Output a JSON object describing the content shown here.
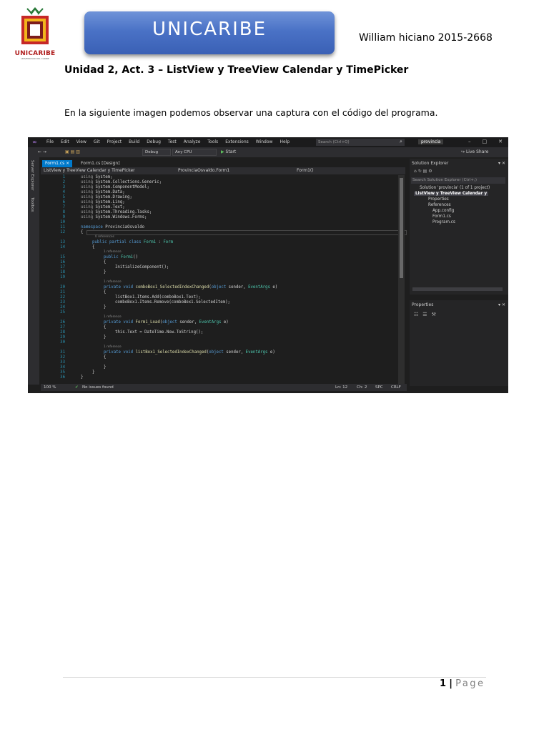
{
  "logo": {
    "text": "UNICARIBE",
    "subtitle": "UNIVERSIDAD DEL CARIBE",
    "colors": [
      "#2a7a3a",
      "#c62828",
      "#f2b51c"
    ]
  },
  "banner": {
    "text": "UNICARIBE",
    "color": "#4a72c6"
  },
  "author": "William hiciano 2015-2668",
  "heading": "Unidad 2, Act. 3 – ListView y TreeView Calendar y TimePicker",
  "paragraph": "En la siguiente imagen podemos observar una captura con el código del programa.",
  "screenshot": {
    "menu": [
      "File",
      "Edit",
      "View",
      "Git",
      "Project",
      "Build",
      "Debug",
      "Test",
      "Analyze",
      "Tools",
      "Extensions",
      "Window",
      "Help"
    ],
    "search_placeholder": "Search (Ctrl+Q)",
    "solution_name": "provincia",
    "config": "Debug",
    "platform": "Any CPU",
    "start": "Start",
    "live_share": "Live Share",
    "side_tabs": [
      "Server Explorer",
      "Toolbox"
    ],
    "tab_active": "Form1.cs",
    "tab_design": "Form1.cs [Design]",
    "nav_project": "ListView y TreeView Calendar y TimePicker",
    "nav_class": "ProvinciaOsvaldo.Form1",
    "nav_member": "Form1()",
    "references_label": "1 reference",
    "zero_references": "0 references",
    "code_lines": [
      {
        "n": "1",
        "u": "System"
      },
      {
        "n": "2",
        "u": "System.Collections.Generic"
      },
      {
        "n": "3",
        "u": "System.ComponentModel"
      },
      {
        "n": "4",
        "u": "System.Data"
      },
      {
        "n": "5",
        "u": "System.Drawing"
      },
      {
        "n": "6",
        "u": "System.Linq"
      },
      {
        "n": "7",
        "u": "System.Text"
      },
      {
        "n": "8",
        "u": "System.Threading.Tasks"
      },
      {
        "n": "9",
        "u": "System.Windows.Forms"
      }
    ],
    "ns_name": "ProvinciaOsvaldo",
    "class_name": "Form1",
    "base_class": "Form",
    "init_call": "InitializeComponent();",
    "method1": "comboBox1_SelectedIndexChanged",
    "m1_line1": "listBox1.Items.Add(comboBox1.Text);",
    "m1_line2": "comboBox1.Items.Remove(comboBox1.SelectedItem);",
    "method2": "Form1_Load",
    "m2_line1": "this.Text = DateTime.Now.ToString();",
    "method3": "listBox1_SelectedIndexChanged",
    "status": {
      "zoom": "100 %",
      "issues": "No issues found",
      "ln": "Ln: 12",
      "ch": "Ch: 2",
      "spc": "SPC",
      "crlf": "CRLF"
    },
    "solution_explorer": {
      "title": "Solution Explorer",
      "search": "Search Solution Explorer (Ctrl+;)",
      "items": [
        "Solution 'provincia' (1 of 1 project)",
        "ListView y TreeView Calendar y",
        "Properties",
        "References",
        "App.config",
        "Form1.cs",
        "Program.cs"
      ]
    },
    "properties_title": "Properties"
  },
  "page": {
    "number": "1",
    "separator": "|",
    "label": "Page"
  }
}
